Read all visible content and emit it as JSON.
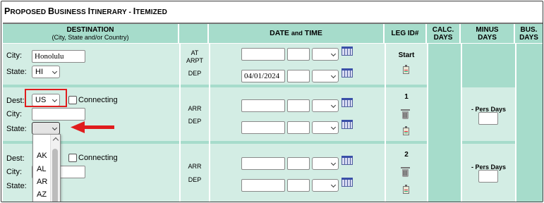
{
  "title": {
    "first_letter": "P",
    "rest": "ROPOSED ",
    "b": "B",
    "b_rest": "USINESS ",
    "i": "I",
    "i_rest": "TINERARY - ",
    "i2": "I",
    "i2_rest": "TEMIZED"
  },
  "headers": {
    "destination": "DESTINATION",
    "destination_sub": "(City, State and/or Country)",
    "date_time": "DATE",
    "date_time_and": "and",
    "date_time_time": "TIME",
    "leg_id": "LEG ID#",
    "calc_days_1": "CALC.",
    "calc_days_2": "DAYS",
    "minus_days_1": "MINUS",
    "minus_days_2": "DAYS",
    "bus_days_1": "BUS.",
    "bus_days_2": "DAYS"
  },
  "row1": {
    "city_label": "City:",
    "city_value": "Honolulu",
    "state_label": "State:",
    "state_value": "HI",
    "at_arpt_1": "AT",
    "at_arpt_2": "ARPT",
    "dep": "DEP",
    "dep_date": "04/01/2024",
    "leg": "Start"
  },
  "row2": {
    "dest_label": "Dest:",
    "dest_value": "US",
    "connecting": "Connecting",
    "city_label": "City:",
    "state_label": "State:",
    "arr": "ARR",
    "dep": "DEP",
    "leg": "1",
    "pers_days": "- Pers Days"
  },
  "row3": {
    "dest_label": "Dest:",
    "connecting": "Connecting",
    "city_label": "City:",
    "state_label": "State:",
    "arr": "ARR",
    "dep": "DEP",
    "leg": "2",
    "pers_days": "- Pers Days"
  },
  "dropdown_options": [
    "AK",
    "AL",
    "AR",
    "AZ"
  ],
  "colors": {
    "header": "#a6dccb",
    "row": "#d3ede4",
    "highlight": "#e01d1d"
  }
}
